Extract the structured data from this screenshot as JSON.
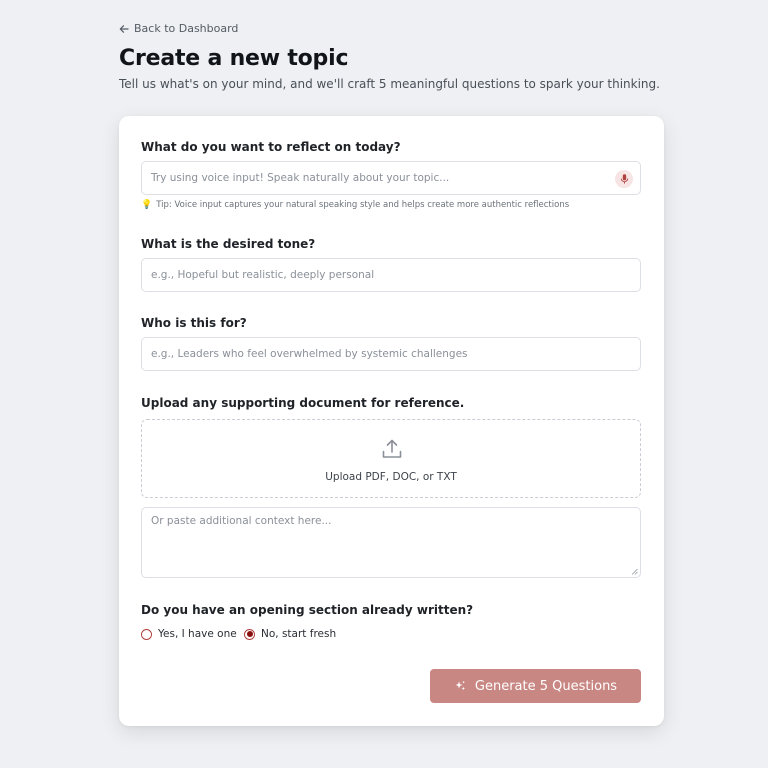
{
  "nav": {
    "back_label": "Back to Dashboard"
  },
  "header": {
    "title": "Create a new topic",
    "subtitle": "Tell us what's on your mind, and we'll craft 5 meaningful questions to spark your thinking."
  },
  "form": {
    "reflect": {
      "label": "What do you want to reflect on today?",
      "placeholder": "Try using voice input! Speak naturally about your topic...",
      "value": "",
      "tip": "Tip: Voice input captures your natural speaking style and helps create more authentic reflections",
      "mic_icon": "microphone-icon",
      "tip_icon": "lightbulb-icon"
    },
    "tone": {
      "label": "What is the desired tone?",
      "placeholder": "e.g., Hopeful but realistic, deeply personal",
      "value": ""
    },
    "audience": {
      "label": "Who is this for?",
      "placeholder": "e.g., Leaders who feel overwhelmed by systemic challenges",
      "value": ""
    },
    "upload": {
      "label": "Upload any supporting document for reference.",
      "text": "Upload PDF, DOC, or TXT",
      "icon": "upload-icon",
      "context_placeholder": "Or paste additional context here...",
      "context_value": ""
    },
    "opening": {
      "label": "Do you have an opening section already written?",
      "options": [
        "Yes, I have one",
        "No, start fresh"
      ],
      "selected": "No, start fresh"
    },
    "submit": {
      "label": "Generate 5 Questions",
      "icon": "sparkles-icon"
    }
  },
  "colors": {
    "accent": "#c98783",
    "radio_selected": "#8b0f0f",
    "background": "#eef0f3"
  }
}
